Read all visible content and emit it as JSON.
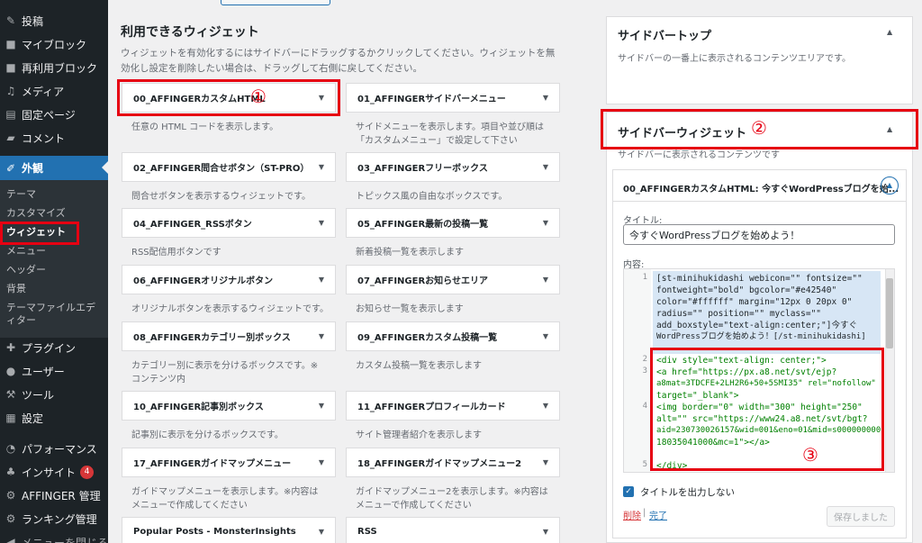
{
  "admin_menu": {
    "items": [
      {
        "label": "投稿",
        "icon": "pin-icon"
      },
      {
        "label": "マイブロック",
        "icon": "grid-icon"
      },
      {
        "label": "再利用ブロック",
        "icon": "grid-icon"
      },
      {
        "label": "メディア",
        "icon": "media-icon"
      },
      {
        "label": "固定ページ",
        "icon": "page-icon"
      },
      {
        "label": "コメント",
        "icon": "comment-icon"
      },
      {
        "label": "外観",
        "icon": "appearance-icon"
      },
      {
        "label": "プラグイン",
        "icon": "plugin-icon"
      },
      {
        "label": "ユーザー",
        "icon": "user-icon"
      },
      {
        "label": "ツール",
        "icon": "wrench-icon"
      },
      {
        "label": "設定",
        "icon": "settings-icon"
      },
      {
        "label": "パフォーマンス",
        "icon": "gauge-icon"
      },
      {
        "label": "インサイト",
        "icon": "insight-icon",
        "badge": "4"
      },
      {
        "label": "AFFINGER 管理",
        "icon": "gear-icon"
      },
      {
        "label": "ランキング管理",
        "icon": "gear-icon"
      },
      {
        "label": "メニューを閉じる",
        "icon": "collapse-icon"
      }
    ],
    "appearance_submenu": [
      "テーマ",
      "カスタマイズ",
      "ウィジェット",
      "メニュー",
      "ヘッダー",
      "背景",
      "テーマファイルエディター"
    ]
  },
  "available": {
    "title": "利用できるウィジェット",
    "description": "ウィジェットを有効化するにはサイドバーにドラッグするかクリックしてください。ウィジェットを無効化し設定を削除したい場合は、ドラッグして右側に戻してください。",
    "widgets": [
      {
        "name": "00_AFFINGERカスタムHTML",
        "desc": "任意の HTML コードを表示します。"
      },
      {
        "name": "01_AFFINGERサイドバーメニュー",
        "desc": "サイドメニューを表示します。項目や並び順は「カスタムメニュー」で設定して下さい"
      },
      {
        "name": "02_AFFINGER問合せボタン（ST-PRO）",
        "desc": "問合せボタンを表示するウィジェットです。"
      },
      {
        "name": "03_AFFINGERフリーボックス",
        "desc": "トピックス風の自由なボックスです。"
      },
      {
        "name": "04_AFFINGER_RSSボタン",
        "desc": "RSS配信用ボタンです"
      },
      {
        "name": "05_AFFINGER最新の投稿一覧",
        "desc": "新着投稿一覧を表示します"
      },
      {
        "name": "06_AFFINGERオリジナルボタン",
        "desc": "オリジナルボタンを表示するウィジェットです。"
      },
      {
        "name": "07_AFFINGERお知らせエリア",
        "desc": "お知らせ一覧を表示します"
      },
      {
        "name": "08_AFFINGERカテゴリー別ボックス",
        "desc": "カテゴリー別に表示を分けるボックスです。※コンテンツ内"
      },
      {
        "name": "09_AFFINGERカスタム投稿一覧",
        "desc": "カスタム投稿一覧を表示します"
      },
      {
        "name": "10_AFFINGER記事別ボックス",
        "desc": "記事別に表示を分けるボックスです。"
      },
      {
        "name": "11_AFFINGERプロフィールカード",
        "desc": "サイト管理者紹介を表示します"
      },
      {
        "name": "17_AFFINGERガイドマップメニュー",
        "desc": "ガイドマップメニューを表示します。※内容はメニューで作成してください"
      },
      {
        "name": "18_AFFINGERガイドマップメニュー2",
        "desc": "ガイドマップメニュー2を表示します。※内容はメニューで作成してください"
      },
      {
        "name": "Popular Posts - MonsterInsights",
        "desc": ""
      },
      {
        "name": "RSS",
        "desc": ""
      }
    ]
  },
  "sidebar_top": {
    "title": "サイドバートップ",
    "desc": "サイドバーの一番上に表示されるコンテンツエリアです。"
  },
  "sidebar_widget": {
    "title": "サイドバーウィジェット",
    "desc": "サイドバーに表示されるコンテンツです",
    "widget_header": "00_AFFINGERカスタムHTML: 今すぐWordPressブログを始...",
    "title_label": "タイトル:",
    "title_value": "今すぐWordPressブログを始めよう！",
    "content_label": "内容:",
    "code_lines": [
      "[st-minihukidashi webicon=\"\" fontsize=\"\"",
      "fontweight=\"bold\" bgcolor=\"#e42540\"",
      "color=\"#ffffff\" margin=\"12px 0 20px 0\"",
      "radius=\"\" position=\"\" myclass=\"\"",
      "add_boxstyle=\"text-align:center;\"]今すぐ",
      "WordPressブログを始めよう！[/st-minihukidashi]",
      "<div style=\"text-align: center;\">",
      "<a href=\"https://px.a8.net/svt/ejp?",
      "a8mat=3TDCFE+2LH2R6+50+5SMI35\" rel=\"nofollow\"",
      "target=\"_blank\">",
      "<img border=\"0\" width=\"300\" height=\"250\"",
      "alt=\"\" src=\"https://www24.a8.net/svt/bgt?",
      "aid=230730026157&wid=001&eno=01&mid=s000000000",
      "18035041000&mc=1\"></a>",
      "</div>"
    ],
    "line_numbers": [
      "1",
      "2",
      "3",
      "4",
      "5"
    ],
    "show_title_label": "タイトルを出力しない",
    "delete_label": "削除",
    "separator": "|",
    "done_label": "完了",
    "save_label": "保存しました"
  },
  "annotations": [
    "①",
    "②",
    "③"
  ],
  "colors": {
    "admin_bg": "#1d2327",
    "accent": "#2271b1",
    "highlight": "#e60012"
  }
}
